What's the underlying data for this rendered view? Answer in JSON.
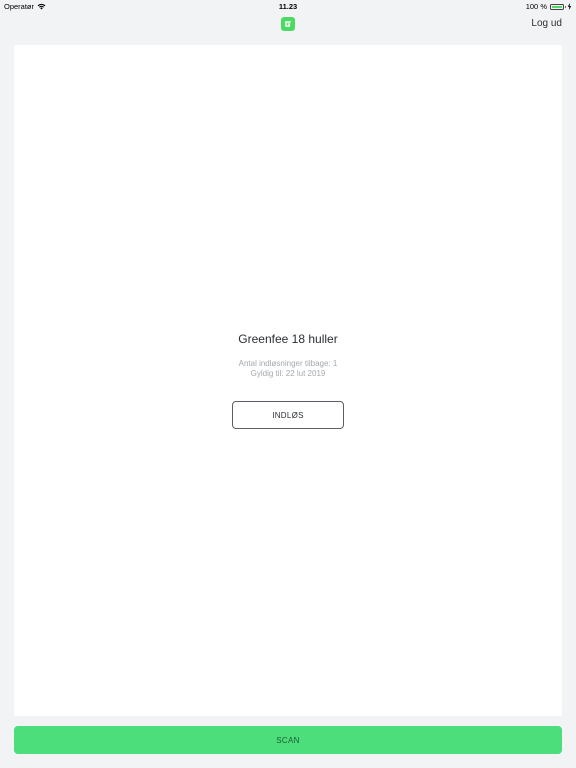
{
  "status_bar": {
    "carrier": "Operatør",
    "wifi_icon": "wifi-icon",
    "time": "11.23",
    "battery_text": "100 %",
    "battery_icon": "battery-icon",
    "charging_icon": "bolt-icon"
  },
  "nav": {
    "logo_icon": "app-logo-icon",
    "logout_label": "Log ud"
  },
  "pass": {
    "title": "Greenfee 18 huller",
    "remaining": "Antal indløsninger tilbage: 1",
    "valid_until": "Gyldig til: 22 lut 2019",
    "redeem_label": "INDLØS"
  },
  "footer": {
    "scan_label": "SCAN"
  },
  "colors": {
    "accent": "#4cde7b",
    "background": "#f2f3f5",
    "card": "#ffffff",
    "muted_text": "#a4a8ad"
  }
}
